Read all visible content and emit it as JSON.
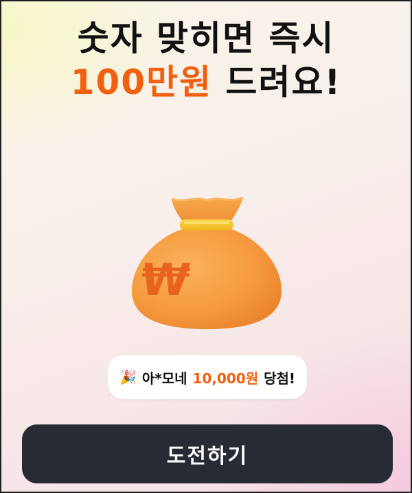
{
  "headline": {
    "line1": "숫자 맞히면 즉시",
    "line2_accent": "100만원",
    "line2_rest": " 드려요!"
  },
  "winner_pill": {
    "icon": "party-popper-icon",
    "name": "아*모네",
    "amount": "10,000원",
    "suffix": "당첨!"
  },
  "bag_symbol": "₩",
  "cta": {
    "label": "도전하기"
  },
  "colors": {
    "accent": "#f2600f",
    "button_bg": "#272c34",
    "bag_orange": "#f59a3e",
    "bag_tie": "#f7c531"
  }
}
